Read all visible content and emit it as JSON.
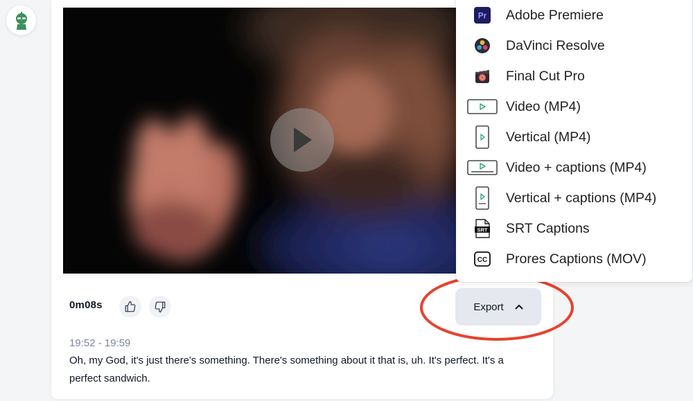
{
  "avatar": {
    "icon": "robot-avatar-icon",
    "color": "#3f8f5f"
  },
  "video": {
    "play_icon": "play-icon"
  },
  "clip": {
    "duration": "0m08s",
    "time_range": "19:52 - 19:59",
    "transcript": "Oh, my God, it's just there's something. There's something about it that is, uh. It's perfect. It's a perfect sandwich."
  },
  "export": {
    "label": "Export",
    "icon": "chevron-up-icon"
  },
  "menu": {
    "items": [
      {
        "label": "Adobe Premiere",
        "icon": "premiere-icon"
      },
      {
        "label": "DaVinci Resolve",
        "icon": "davinci-icon"
      },
      {
        "label": "Final Cut Pro",
        "icon": "final-cut-icon"
      },
      {
        "label": "Video (MP4)",
        "icon": "video-landscape-icon"
      },
      {
        "label": "Vertical (MP4)",
        "icon": "video-vertical-icon"
      },
      {
        "label": "Video + captions (MP4)",
        "icon": "video-landscape-captions-icon"
      },
      {
        "label": "Vertical + captions (MP4)",
        "icon": "video-vertical-captions-icon"
      },
      {
        "label": "SRT Captions",
        "icon": "srt-icon"
      },
      {
        "label": "Prores Captions (MOV)",
        "icon": "cc-icon"
      }
    ]
  },
  "colors": {
    "annotation": "#e8422f",
    "export_bg": "#e5e8ee",
    "premiere": "#1f1b5e",
    "premiere_text": "#9a9bff"
  }
}
